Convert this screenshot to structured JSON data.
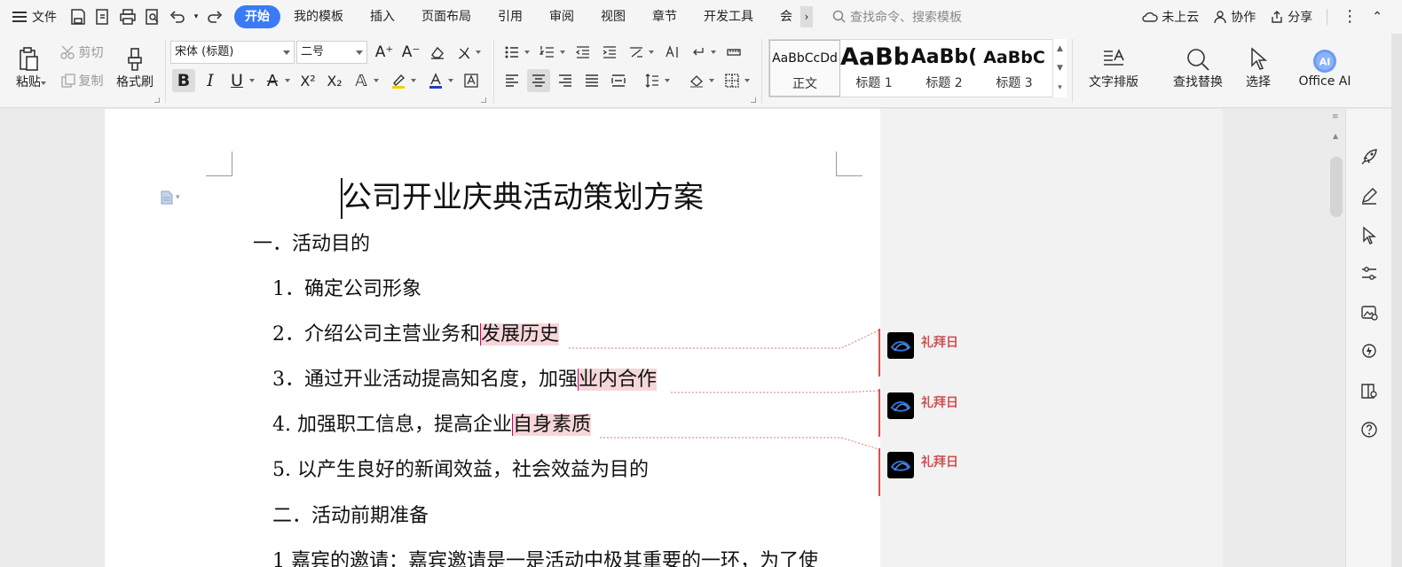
{
  "menu": {
    "file_label": "文件",
    "tabs": [
      "开始",
      "我的模板",
      "插入",
      "页面布局",
      "引用",
      "审阅",
      "视图",
      "章节",
      "开发工具",
      "会"
    ],
    "active_tab_index": 0,
    "search_placeholder": "查找命令、搜索模板",
    "cloud_label": "未上云",
    "collab_label": "协作",
    "share_label": "分享"
  },
  "ribbon": {
    "paste_label": "粘贴",
    "cut_label": "剪切",
    "copy_label": "复制",
    "format_painter_label": "格式刷",
    "font_name": "宋体 (标题)",
    "font_size": "二号",
    "font_size_icons": [
      "A⁺",
      "A⁻"
    ],
    "bold": "B",
    "italic": "I",
    "underline": "U",
    "superscript": "X²",
    "subscript": "X₂",
    "styles": [
      {
        "preview": "AaBbCcDd",
        "label": "正文"
      },
      {
        "preview": "AaBb",
        "label": "标题 1"
      },
      {
        "preview": "AaBb(",
        "label": "标题 2"
      },
      {
        "preview": "AaBbC",
        "label": "标题 3"
      }
    ],
    "text_layout_label": "文字排版",
    "find_replace_label": "查找替换",
    "select_label": "选择",
    "office_ai_label": "Office AI",
    "ai_badge": "AI"
  },
  "document": {
    "title": "公司开业庆典活动策划方案",
    "lines": [
      "一．活动目的",
      "1．确定公司形象",
      "2．介绍公司主营业务和",
      "3．通过开业活动提高知名度，加强",
      "4. 加强职工信息，提高企业",
      "5. 以产生良好的新闻效益，社会效益为目的",
      "二．活动前期准备",
      "1 嘉宾的邀请：嘉宾邀请是一是活动中极其重要的一环，为了使"
    ],
    "highlights": [
      "发展历史",
      "业内合作",
      "自身素质"
    ]
  },
  "comments": [
    {
      "author": "礼拜日"
    },
    {
      "author": "礼拜日"
    },
    {
      "author": "礼拜日"
    }
  ],
  "colors": {
    "accent": "#3a7bf5",
    "highlight": "#f6d7d9",
    "comment_author": "#d05050",
    "font_color_bar": "#1f3fbf",
    "highlighter_bar": "#f2d000"
  },
  "icons": {
    "rail": [
      "rocket-icon",
      "pen-icon",
      "pointer-icon",
      "sliders-icon",
      "image-edit-icon",
      "location-icon",
      "book-icon",
      "help-icon"
    ]
  }
}
